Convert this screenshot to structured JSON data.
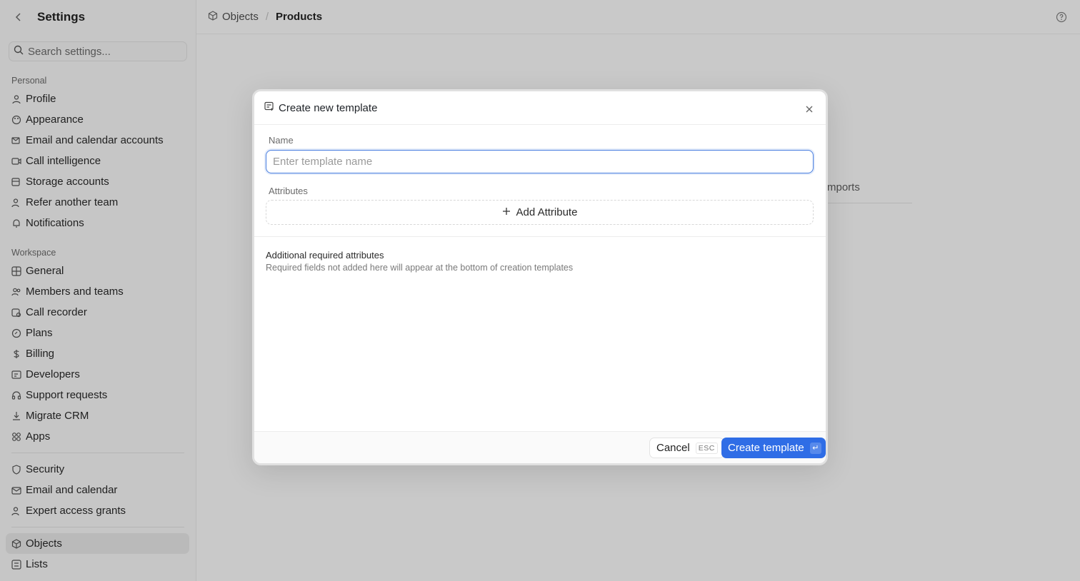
{
  "sidebar": {
    "title": "Settings",
    "search_placeholder": "Search settings...",
    "personal_label": "Personal",
    "personal": [
      {
        "label": "Profile",
        "icon": "user-icon"
      },
      {
        "label": "Appearance",
        "icon": "palette-icon"
      },
      {
        "label": "Email and calendar accounts",
        "icon": "mail-settings-icon"
      },
      {
        "label": "Call intelligence",
        "icon": "video-icon"
      },
      {
        "label": "Storage accounts",
        "icon": "storage-icon"
      },
      {
        "label": "Refer another team",
        "icon": "user-plus-icon"
      },
      {
        "label": "Notifications",
        "icon": "bell-icon"
      }
    ],
    "workspace_label": "Workspace",
    "workspace": [
      {
        "label": "General",
        "icon": "grid-icon"
      },
      {
        "label": "Members and teams",
        "icon": "users-icon"
      },
      {
        "label": "Call recorder",
        "icon": "recorder-icon"
      },
      {
        "label": "Plans",
        "icon": "plans-icon"
      },
      {
        "label": "Billing",
        "icon": "dollar-icon"
      },
      {
        "label": "Developers",
        "icon": "code-icon"
      },
      {
        "label": "Support requests",
        "icon": "headphones-icon"
      },
      {
        "label": "Migrate CRM",
        "icon": "download-icon"
      },
      {
        "label": "Apps",
        "icon": "apps-icon"
      }
    ],
    "security": [
      {
        "label": "Security",
        "icon": "shield-icon"
      },
      {
        "label": "Email and calendar",
        "icon": "envelope-icon"
      },
      {
        "label": "Expert access grants",
        "icon": "user-key-icon"
      }
    ],
    "data": [
      {
        "label": "Objects",
        "icon": "cube-icon",
        "active": true
      },
      {
        "label": "Lists",
        "icon": "list-icon"
      }
    ]
  },
  "breadcrumb": {
    "parent": "Objects",
    "current": "Products"
  },
  "background": {
    "tab_fragment": "mports"
  },
  "modal": {
    "title": "Create new template",
    "name_label": "Name",
    "name_placeholder": "Enter template name",
    "name_value": "",
    "attributes_label": "Attributes",
    "add_attribute_label": "Add Attribute",
    "required_title": "Additional required attributes",
    "required_subtitle": "Required fields not added here will appear at the bottom of creation templates",
    "cancel_label": "Cancel",
    "cancel_shortcut": "ESC",
    "create_label": "Create template",
    "create_shortcut": "↵"
  },
  "colors": {
    "accent": "#2f6de6",
    "overlay": "#c9c9c9"
  }
}
